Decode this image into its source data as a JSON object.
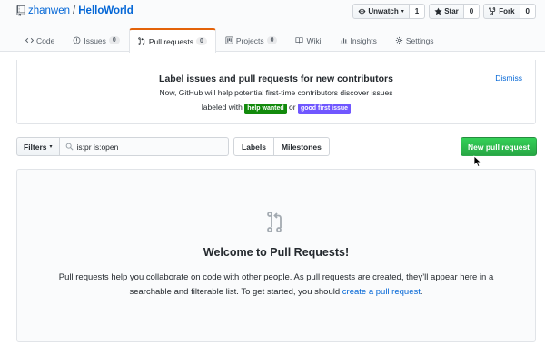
{
  "repo": {
    "owner": "zhanwen",
    "separator": "/",
    "name": "HelloWorld"
  },
  "actions": {
    "watch": {
      "label": "Unwatch",
      "count": "1"
    },
    "star": {
      "label": "Star",
      "count": "0"
    },
    "fork": {
      "label": "Fork",
      "count": "0"
    }
  },
  "tabs": [
    {
      "label": "Code",
      "icon": "code-icon"
    },
    {
      "label": "Issues",
      "count": "0",
      "icon": "issue-icon"
    },
    {
      "label": "Pull requests",
      "count": "0",
      "icon": "git-pull-request-icon",
      "selected": true
    },
    {
      "label": "Projects",
      "count": "0",
      "icon": "project-icon"
    },
    {
      "label": "Wiki",
      "icon": "book-icon"
    },
    {
      "label": "Insights",
      "icon": "graph-icon"
    },
    {
      "label": "Settings",
      "icon": "gear-icon"
    }
  ],
  "banner": {
    "title": "Label issues and pull requests for new contributors",
    "line1": "Now, GitHub will help potential first-time contributors discover issues",
    "line2_prefix": "labeled with",
    "label_help_wanted": "help wanted",
    "line2_or": "or",
    "label_good_first_issue": "good first issue",
    "dismiss": "Dismiss"
  },
  "subnav": {
    "filters_label": "Filters",
    "search_value": "is:pr is:open",
    "labels_label": "Labels",
    "milestones_label": "Milestones",
    "new_pr_label": "New pull request"
  },
  "blankslate": {
    "title": "Welcome to Pull Requests!",
    "text_1": "Pull requests help you collaborate on code with other people. As pull requests are created, they’ll appear here in a searchable and filterable list. To get started, you should",
    "link": "create a pull request",
    "text_2": "."
  },
  "colors": {
    "accent_link": "#0366d6",
    "tab_selected_border": "#e36209",
    "new_pr_button": "#28a745",
    "label_help_wanted": "#128a0c",
    "label_good_first_issue": "#7057ff"
  }
}
